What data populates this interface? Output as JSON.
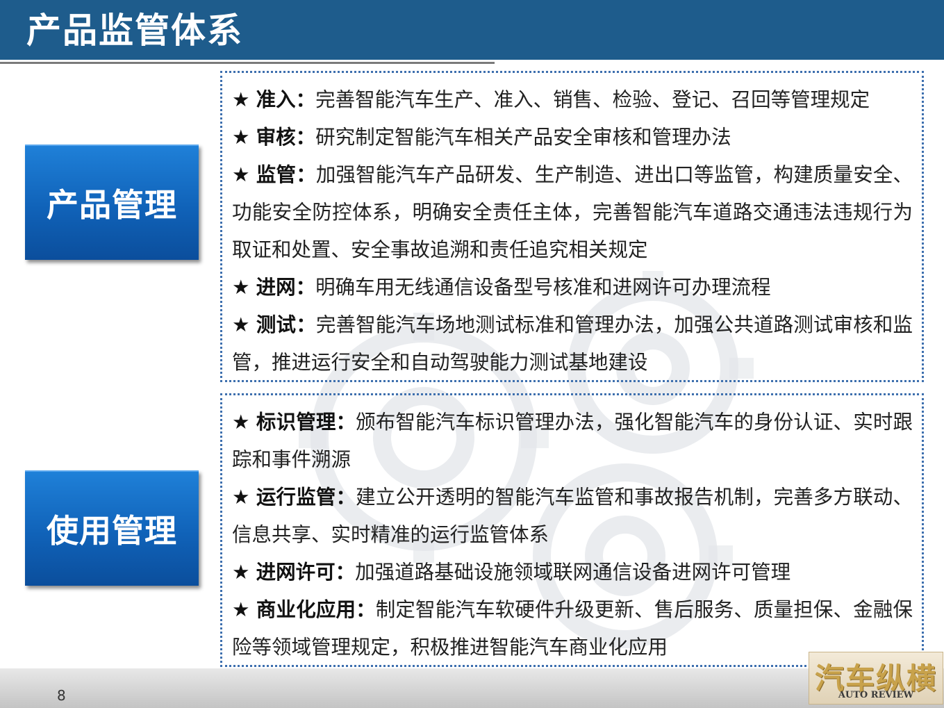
{
  "header": {
    "title": "产品监管体系"
  },
  "sections": [
    {
      "label": "产品管理",
      "items": [
        {
          "star": "★",
          "label": "准入：",
          "text": "完善智能汽车生产、准入、销售、检验、登记、召回等管理规定"
        },
        {
          "star": "★",
          "label": "审核：",
          "text": "研究制定智能汽车相关产品安全审核和管理办法"
        },
        {
          "star": "★",
          "label": "监管：",
          "text": "加强智能汽车产品研发、生产制造、进出口等监管，构建质量安全、功能安全防控体系，明确安全责任主体，完善智能汽车道路交通违法违规行为取证和处置、安全事故追溯和责任追究相关规定"
        },
        {
          "star": "★",
          "label": "进网：",
          "text": "明确车用无线通信设备型号核准和进网许可办理流程"
        },
        {
          "star": "★",
          "label": "测试：",
          "text": "完善智能汽车场地测试标准和管理办法，加强公共道路测试审核和监管，推进运行安全和自动驾驶能力测试基地建设"
        }
      ]
    },
    {
      "label": "使用管理",
      "items": [
        {
          "star": "★",
          "label": "标识管理：",
          "text": "颁布智能汽车标识管理办法，强化智能汽车的身份认证、实时跟踪和事件溯源"
        },
        {
          "star": "★",
          "label": "运行监管：",
          "text": "建立公开透明的智能汽车监管和事故报告机制，完善多方联动、信息共享、实时精准的运行监管体系"
        },
        {
          "star": "★",
          "label": "进网许可：",
          "text": "加强道路基础设施领域联网通信设备进网许可管理"
        },
        {
          "star": "★",
          "label": "商业化应用：",
          "text": "制定智能汽车软硬件升级更新、售后服务、质量担保、金融保险等领域管理规定，积极推进智能汽车商业化应用"
        }
      ]
    }
  ],
  "footer": {
    "page_number": "8"
  },
  "logo": {
    "text": "汽车纵横",
    "subtext": "AUTO REVIEW"
  }
}
